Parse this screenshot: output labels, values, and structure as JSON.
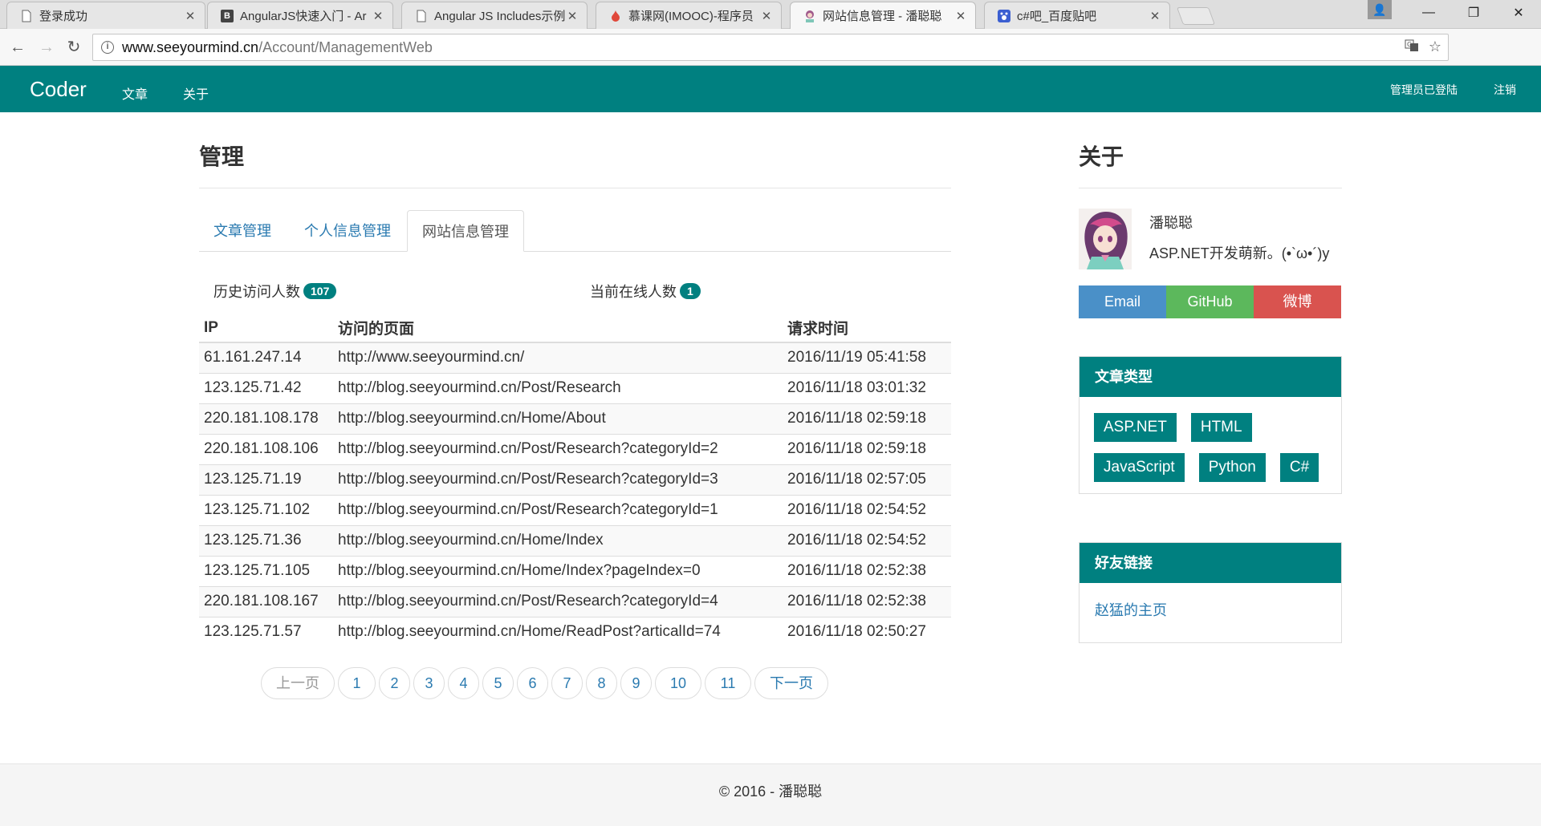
{
  "browser": {
    "tabs": [
      {
        "title": "登录成功",
        "icon": "page-icon"
      },
      {
        "title": "AngularJS快速入门 - Ar",
        "icon": "b-icon"
      },
      {
        "title": "Angular JS Includes示例",
        "icon": "page-icon"
      },
      {
        "title": "慕课网(IMOOC)-程序员",
        "icon": "flame-icon"
      },
      {
        "title": "网站信息管理 - 潘聪聪",
        "icon": "avatar-icon"
      },
      {
        "title": "c#吧_百度贴吧",
        "icon": "paw-icon"
      }
    ],
    "url_host": "www.seeyourmind.cn",
    "url_path": "/Account/ManagementWeb"
  },
  "navbar": {
    "brand": "Coder",
    "links": [
      "文章",
      "关于"
    ],
    "right": [
      "管理员已登陆",
      "注销"
    ],
    "color": "#008080"
  },
  "main": {
    "title": "管理",
    "tabs": [
      "文章管理",
      "个人信息管理",
      "网站信息管理"
    ],
    "active_tab": 2,
    "stats": {
      "history_label": "历史访问人数",
      "history_count": "107",
      "online_label": "当前在线人数",
      "online_count": "1"
    },
    "table": {
      "headers": [
        "IP",
        "访问的页面",
        "请求时间"
      ],
      "rows": [
        [
          "61.161.247.14",
          "http://www.seeyourmind.cn/",
          "2016/11/19 05:41:58"
        ],
        [
          "123.125.71.42",
          "http://blog.seeyourmind.cn/Post/Research",
          "2016/11/18 03:01:32"
        ],
        [
          "220.181.108.178",
          "http://blog.seeyourmind.cn/Home/About",
          "2016/11/18 02:59:18"
        ],
        [
          "220.181.108.106",
          "http://blog.seeyourmind.cn/Post/Research?categoryId=2",
          "2016/11/18 02:59:18"
        ],
        [
          "123.125.71.19",
          "http://blog.seeyourmind.cn/Post/Research?categoryId=3",
          "2016/11/18 02:57:05"
        ],
        [
          "123.125.71.102",
          "http://blog.seeyourmind.cn/Post/Research?categoryId=1",
          "2016/11/18 02:54:52"
        ],
        [
          "123.125.71.36",
          "http://blog.seeyourmind.cn/Home/Index",
          "2016/11/18 02:54:52"
        ],
        [
          "123.125.71.105",
          "http://blog.seeyourmind.cn/Home/Index?pageIndex=0",
          "2016/11/18 02:52:38"
        ],
        [
          "220.181.108.167",
          "http://blog.seeyourmind.cn/Post/Research?categoryId=4",
          "2016/11/18 02:52:38"
        ],
        [
          "123.125.71.57",
          "http://blog.seeyourmind.cn/Home/ReadPost?articalId=74",
          "2016/11/18 02:50:27"
        ]
      ]
    },
    "pager": {
      "prev": "上一页",
      "pages": [
        "1",
        "2",
        "3",
        "4",
        "5",
        "6",
        "7",
        "8",
        "9",
        "10",
        "11"
      ],
      "next": "下一页"
    }
  },
  "sidebar": {
    "title": "关于",
    "author": "潘聪聪",
    "motto": "ASP.NET开发萌新。(•`ω•´)y",
    "social": [
      {
        "label": "Email",
        "color": "#4a90c8"
      },
      {
        "label": "GitHub",
        "color": "#5cb85c"
      },
      {
        "label": "微博",
        "color": "#d9534f"
      }
    ],
    "categories_title": "文章类型",
    "categories": [
      "ASP.NET",
      "HTML",
      "JavaScript",
      "Python",
      "C#"
    ],
    "friends_title": "好友链接",
    "friends": [
      "赵猛的主页"
    ]
  },
  "footer": {
    "text": "© 2016 - 潘聪聪"
  }
}
